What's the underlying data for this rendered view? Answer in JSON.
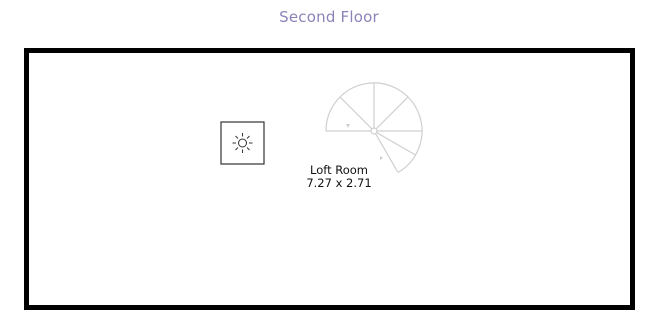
{
  "floor": {
    "title": "Second Floor"
  },
  "room": {
    "name": "Loft Room",
    "dimensions": "7.27 x 2.71"
  },
  "fixtures": {
    "light_icon": "ceiling-light-icon",
    "stair_icon": "spiral-staircase-icon"
  },
  "colors": {
    "title": "#8b84b8",
    "wall": "#000000",
    "stair": "#cfcfcf"
  }
}
